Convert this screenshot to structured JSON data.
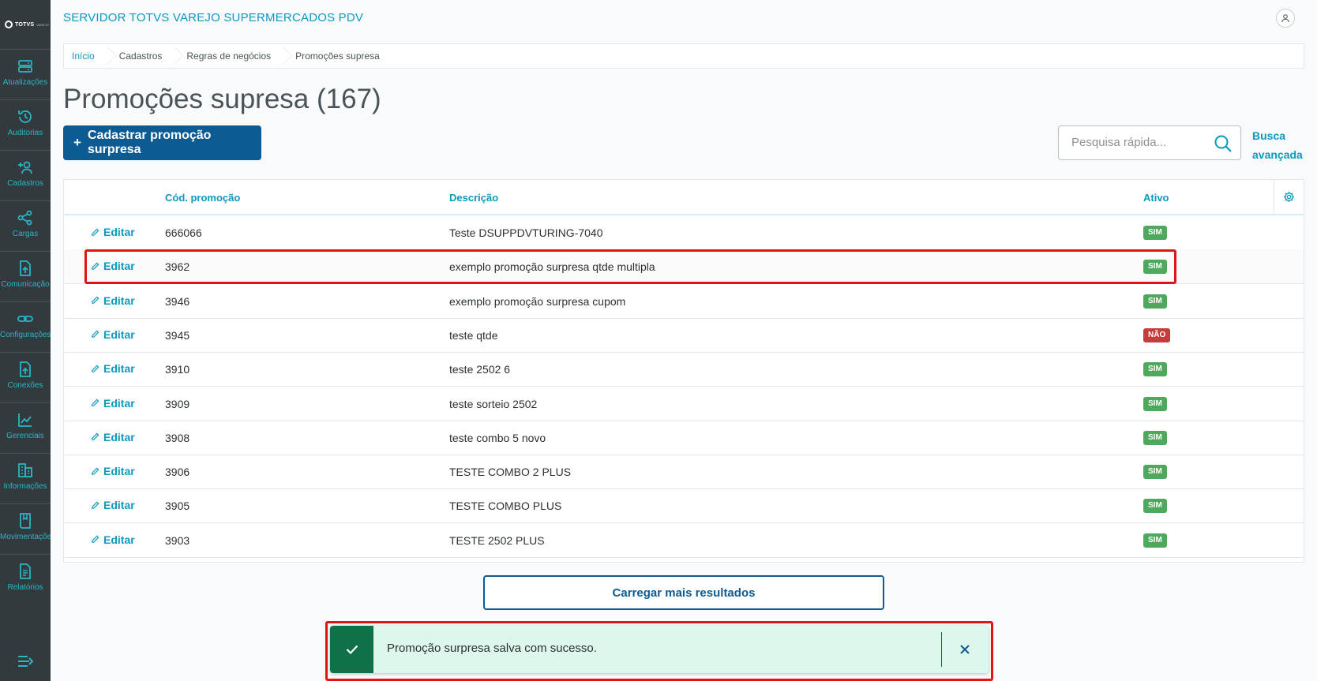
{
  "app": {
    "title": "SERVIDOR TOTVS VAREJO SUPERMERCADOS PDV",
    "logo_text": "TOTVS",
    "logo_sub": "VAREJO"
  },
  "sidebar": {
    "items": [
      {
        "label": "Atualizações",
        "icon": "server-icon"
      },
      {
        "label": "Auditorias",
        "icon": "history-icon"
      },
      {
        "label": "Cadastros",
        "icon": "add-user-icon"
      },
      {
        "label": "Cargas",
        "icon": "share-icon"
      },
      {
        "label": "Comunicação",
        "icon": "upload-file-icon"
      },
      {
        "label": "Configurações",
        "icon": "link-icon"
      },
      {
        "label": "Conexões",
        "icon": "upload-file-icon"
      },
      {
        "label": "Gerenciais",
        "icon": "chart-icon"
      },
      {
        "label": "Informações",
        "icon": "building-icon"
      },
      {
        "label": "Movimentações",
        "icon": "book-icon"
      },
      {
        "label": "Relatórios",
        "icon": "document-icon"
      }
    ]
  },
  "breadcrumb": [
    "Início",
    "Cadastros",
    "Regras de negócios",
    "Promoções supresa"
  ],
  "page": {
    "title": "Promoções supresa (167)",
    "new_button": "Cadastrar promoção surpresa",
    "search_placeholder": "Pesquisa rápida...",
    "advanced_search_line1": "Busca",
    "advanced_search_line2": "avançada",
    "load_more": "Carregar mais resultados"
  },
  "table": {
    "columns": [
      "Cód. promoção",
      "Descrição",
      "Ativo"
    ],
    "edit_label": "Editar",
    "rows": [
      {
        "code": "666066",
        "description": "Teste DSUPPDVTURING-7040",
        "active": "SIM"
      },
      {
        "code": "3962",
        "description": "exemplo promoção surpresa qtde multipla",
        "active": "SIM"
      },
      {
        "code": "3946",
        "description": "exemplo promoção surpresa cupom",
        "active": "SIM"
      },
      {
        "code": "3945",
        "description": "teste qtde",
        "active": "NÃO"
      },
      {
        "code": "3910",
        "description": "teste 2502 6",
        "active": "SIM"
      },
      {
        "code": "3909",
        "description": "teste sorteio 2502",
        "active": "SIM"
      },
      {
        "code": "3908",
        "description": "teste combo 5 novo",
        "active": "SIM"
      },
      {
        "code": "3906",
        "description": "TESTE COMBO 2 PLUS",
        "active": "SIM"
      },
      {
        "code": "3905",
        "description": "TESTE COMBO PLUS",
        "active": "SIM"
      },
      {
        "code": "3903",
        "description": "TESTE 2502 PLUS",
        "active": "SIM"
      }
    ]
  },
  "toast": {
    "message": "Promoção surpresa salva com sucesso."
  },
  "colors": {
    "accent": "#0c9abe",
    "primary": "#0c5b92",
    "sidebar": "#323a3e",
    "success": "#4daa5c",
    "danger": "#c63b3b",
    "highlight": "#e01414"
  }
}
